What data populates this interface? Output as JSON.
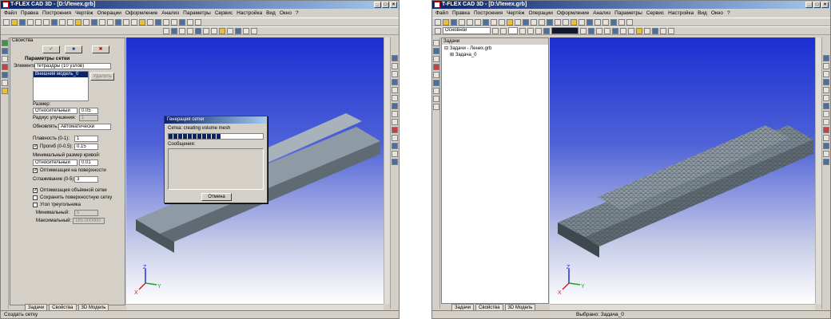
{
  "window1": {
    "title": "T-FLEX CAD 3D - [D:\\Ленех.grb]",
    "menu": [
      "Файл",
      "Правка",
      "Построения",
      "Чертёж",
      "Операции",
      "Оформление",
      "Анализ",
      "Параметры",
      "Сервис",
      "Настройка",
      "Вид",
      "Окно",
      "?"
    ],
    "panel": {
      "header": "Свойства",
      "section": "Параметры сетки",
      "elements_label": "Элементы:",
      "elements_value": "тетраэдры (10 узлов)",
      "list_item": "Внешняя модель_0",
      "delete_button": "Удалить",
      "size_label": "Размер:",
      "size_mode": "Относительный",
      "size_value": "0.05",
      "refine_label": "Радиус улучшения:",
      "refine_value": "1",
      "update_label": "Обновлять:",
      "update_value": "Автоматически",
      "smooth_label": "Плавность (0-1):",
      "smooth_value": "1",
      "sag_label": "Прогиб (0-0.5):",
      "sag_value": "0.15",
      "min_curve_label": "Минимальный размер кривой:",
      "min_curve_mode": "Относительный",
      "min_curve_value": "0.01",
      "opt_surface_label": "Оптимизация на поверхности",
      "smoothing_label": "Сглаживание (0-5):",
      "smoothing_value": "3",
      "opt_volume_label": "Оптимизация объёмной сетки",
      "keep_surface_label": "Сохранить поверхностную сетку",
      "triangle_angle_label": "Угол треугольника",
      "min_label": "Минимальный:",
      "min_value": "5",
      "max_label": "Максимальный:",
      "max_value": "165.000000"
    },
    "tabs": [
      "Задачи",
      "Свойства",
      "3D Модель"
    ],
    "status": "Создать сетку",
    "dialog": {
      "title": "Генерация сетки",
      "mesh_text": "Сетка:  creating volume mesh",
      "progress": 0.55,
      "messages_label": "Сообщения:",
      "cancel": "Отмена"
    }
  },
  "window2": {
    "title": "T-FLEX CAD 3D - [D:\\Ленех.grb]",
    "menu": [
      "Файл",
      "Правка",
      "Построения",
      "Чертёж",
      "Операции",
      "Оформление",
      "Анализ",
      "Параметры",
      "Сервис",
      "Настройка",
      "Вид",
      "Окно",
      "?"
    ],
    "layer_combo": "Основной",
    "tasks_header": "Задачи",
    "tree_root": "Задачи - Ленех.grb",
    "tree_child": "Задача_0",
    "tabs": [
      "Задачи",
      "Свойства",
      "3D Модель"
    ],
    "status": "Выбрано: Задача_0"
  },
  "axes": {
    "x": "X",
    "y": "Y",
    "z": "Z"
  },
  "colors": {
    "title_from": "#0a246a",
    "title_to": "#a6caf0",
    "viewport_top": "#1b2fd2",
    "part": "#7d8a93",
    "mesh": "#5f6a72"
  }
}
